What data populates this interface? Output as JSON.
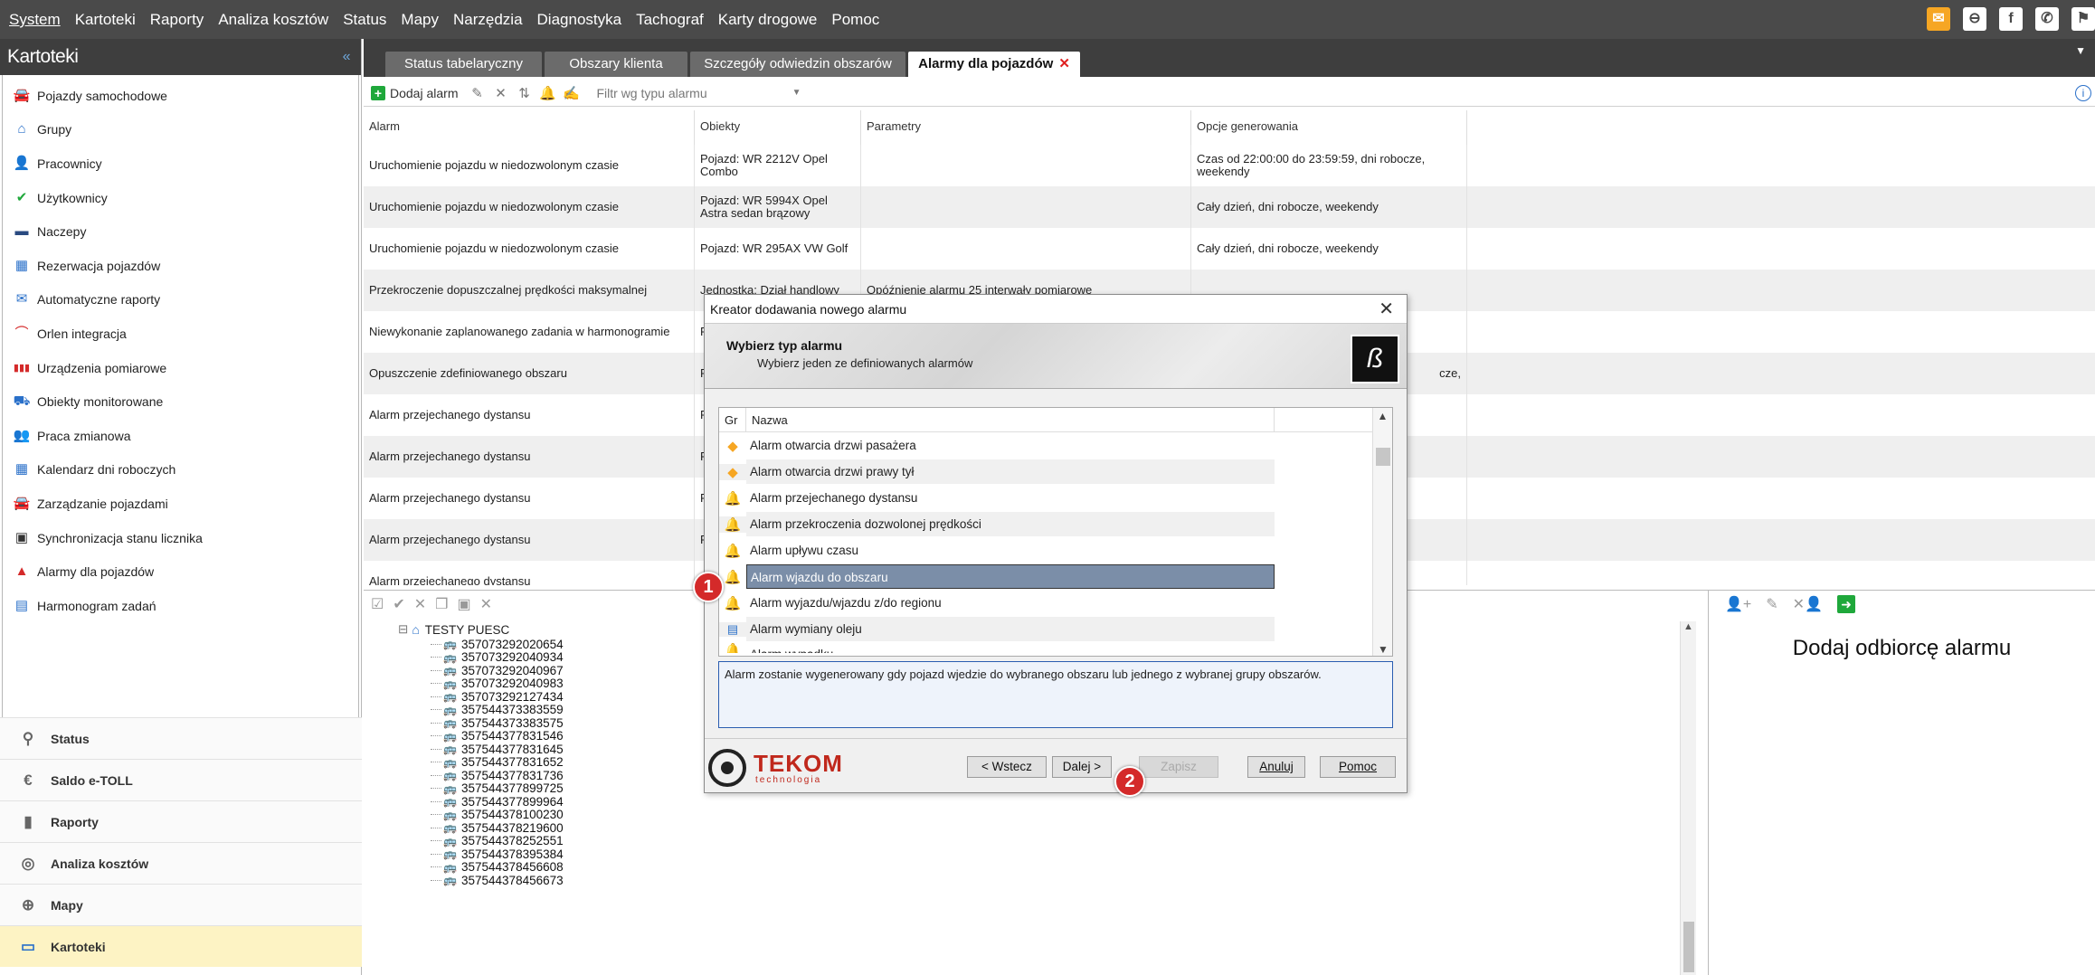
{
  "menu": {
    "items": [
      "System",
      "Kartoteki",
      "Raporty",
      "Analiza kosztów",
      "Status",
      "Mapy",
      "Narzędzia",
      "Diagnostyka",
      "Tachograf",
      "Karty drogowe",
      "Pomoc"
    ]
  },
  "left_panel": {
    "title": "Kartoteki",
    "items": [
      {
        "label": "Pojazdy samochodowe",
        "icon": "car-icon"
      },
      {
        "label": "Grupy",
        "icon": "home-icon"
      },
      {
        "label": "Pracownicy",
        "icon": "person-icon"
      },
      {
        "label": "Użytkownicy",
        "icon": "user-check-icon"
      },
      {
        "label": "Naczepy",
        "icon": "trailer-icon"
      },
      {
        "label": "Rezerwacja pojazdów",
        "icon": "calendar-icon"
      },
      {
        "label": "Automatyczne raporty",
        "icon": "mail-clock-icon"
      },
      {
        "label": "Orlen integracja",
        "icon": "orlen-icon"
      },
      {
        "label": "Urządzenia pomiarowe",
        "icon": "bars-icon"
      },
      {
        "label": "Obiekty monitorowane",
        "icon": "truck-search-icon"
      },
      {
        "label": "Praca zmianowa",
        "icon": "shift-icon"
      },
      {
        "label": "Kalendarz dni roboczych",
        "icon": "calendar-days-icon"
      },
      {
        "label": "Zarządzanie pojazdami",
        "icon": "car-manage-icon"
      },
      {
        "label": "Synchronizacja stanu licznika",
        "icon": "counter-icon"
      },
      {
        "label": "Alarmy dla pojazdów",
        "icon": "warning-icon"
      },
      {
        "label": "Harmonogram zadań",
        "icon": "schedule-icon"
      }
    ]
  },
  "bottom_nav": [
    {
      "label": "Status",
      "icon": "pin-icon"
    },
    {
      "label": "Saldo e-TOLL",
      "icon": "toll-icon"
    },
    {
      "label": "Raporty",
      "icon": "chart-icon"
    },
    {
      "label": "Analiza kosztów",
      "icon": "coins-icon"
    },
    {
      "label": "Mapy",
      "icon": "globe-icon"
    },
    {
      "label": "Kartoteki",
      "icon": "folder-icon"
    }
  ],
  "tabs": [
    {
      "label": "Status tabelaryczny"
    },
    {
      "label": "Obszary klienta"
    },
    {
      "label": "Szczegóły odwiedzin obszarów"
    },
    {
      "label": "Alarmy dla pojazdów"
    }
  ],
  "toolbar": {
    "add_label": "Dodaj alarm",
    "filter_placeholder": "Filtr wg typu alarmu"
  },
  "grid": {
    "columns": [
      "Alarm",
      "Obiekty",
      "Parametry",
      "Opcje generowania"
    ],
    "rows": [
      [
        "Uruchomienie pojazdu w niedozwolonym czasie",
        "Pojazd: WR 2212V Opel Combo",
        "",
        "Czas od 22:00:00 do 23:59:59, dni robocze, weekendy"
      ],
      [
        "Uruchomienie pojazdu w niedozwolonym czasie",
        "Pojazd: WR 5994X Opel Astra sedan brązowy",
        "",
        "Cały dzień, dni robocze, weekendy"
      ],
      [
        "Uruchomienie pojazdu w niedozwolonym czasie",
        "Pojazd: WR 295AX VW Golf",
        "",
        "Cały dzień, dni robocze, weekendy"
      ],
      [
        "Przekroczenie dopuszczalnej prędkości maksymalnej",
        "Jednostka: Dział handlowy",
        "Opóźnienie alarmu 25 interwały pomiarowe",
        ""
      ],
      [
        "Niewykonanie zaplanowanego zadania w harmonogramie",
        "F",
        "",
        ""
      ],
      [
        "Opuszczenie zdefiniowanego obszaru",
        "F",
        "",
        "cze,"
      ],
      [
        "Alarm przejechanego dystansu",
        "F",
        "",
        ""
      ],
      [
        "Alarm przejechanego dystansu",
        "F",
        "",
        ""
      ],
      [
        "Alarm przejechanego dystansu",
        "F",
        "",
        ""
      ],
      [
        "Alarm przejechanego dystansu",
        "F",
        "",
        ""
      ],
      [
        "Alarm przejechanego dystansu",
        "",
        "",
        ""
      ]
    ]
  },
  "tree": {
    "root": "TESTY PUESC",
    "items": [
      "357073292020654",
      "357073292040934",
      "357073292040967",
      "357073292040983",
      "357073292127434",
      "357544373383559",
      "357544373383575",
      "357544377831546",
      "357544377831645",
      "357544377831652",
      "357544377831736",
      "357544377899725",
      "357544377899964",
      "357544378100230",
      "357544378219600",
      "357544378252551",
      "357544378395384",
      "357544378456608",
      "357544378456673"
    ]
  },
  "recipients": {
    "title": "Dodaj odbiorcę alarmu"
  },
  "dialog": {
    "title": "Kreator dodawania nowego alarmu",
    "heading": "Wybierz typ alarmu",
    "subheading": "Wybierz jeden ze definiowanych alarmów",
    "list_headers": {
      "group": "Gr",
      "name": "Nazwa"
    },
    "items": [
      {
        "label": "Alarm otwarcia drzwi pasażera",
        "icon": "warning-diamond-icon"
      },
      {
        "label": "Alarm otwarcia drzwi prawy tył",
        "icon": "warning-diamond-icon"
      },
      {
        "label": "Alarm przejechanego dystansu",
        "icon": "bell-icon"
      },
      {
        "label": "Alarm przekroczenia dozwolonej prędkości",
        "icon": "bell-icon"
      },
      {
        "label": "Alarm upływu czasu",
        "icon": "bell-icon"
      },
      {
        "label": "Alarm wjazdu do obszaru",
        "icon": "bell-icon"
      },
      {
        "label": "Alarm wyjazdu/wjazdu z/do regionu",
        "icon": "bell-icon"
      },
      {
        "label": "Alarm wymiany oleju",
        "icon": "oil-icon"
      },
      {
        "label": "Alarm wypadku",
        "icon": "bell-icon"
      }
    ],
    "selected_index": 5,
    "description": "Alarm zostanie wygenerowany gdy pojazd wjedzie do wybranego obszaru lub jednego z wybranej grupy obszarów.",
    "brand": "TEKOM",
    "brand_sub": "technologia",
    "buttons": {
      "back": "< Wstecz",
      "next": "Dalej >",
      "save": "Zapisz",
      "cancel": "Anuluj",
      "help": "Pomoc"
    }
  },
  "badges": [
    "1",
    "2"
  ]
}
